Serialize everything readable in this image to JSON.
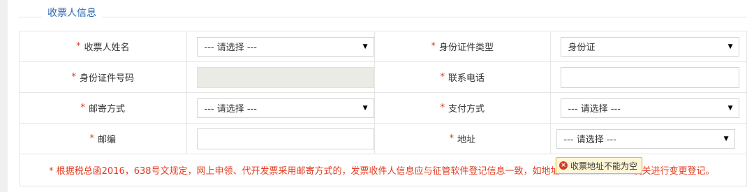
{
  "section": {
    "title": "收票人信息"
  },
  "rows": [
    {
      "left": {
        "label": "收票人姓名",
        "required": "*",
        "type": "select",
        "value": "--- 请选择 ---"
      },
      "right": {
        "label": "身份证件类型",
        "required": "*",
        "type": "select",
        "value": "身份证"
      }
    },
    {
      "left": {
        "label": "身份证件号码",
        "required": "*",
        "type": "input-disabled",
        "value": ""
      },
      "right": {
        "label": "联系电话",
        "required": "*",
        "type": "input",
        "value": ""
      }
    },
    {
      "left": {
        "label": "邮寄方式",
        "required": "*",
        "type": "select",
        "value": "--- 请选择 ---"
      },
      "right": {
        "label": "支付方式",
        "required": "*",
        "type": "select",
        "value": "--- 请选择 ---"
      }
    },
    {
      "left": {
        "label": "邮编",
        "required": "*",
        "type": "input",
        "value": ""
      },
      "right": {
        "label": "地址",
        "required": "*",
        "type": "select",
        "value": "--- 请选择 ---"
      }
    }
  ],
  "note": {
    "text_before": "* 根据税总函2016，638号文规定，网上申领、代开发票采用邮寄方式的，发票收件人信息应与征管软件登记信息一致，如地址",
    "text_after": "机关进行变更登记。"
  },
  "tooltip": {
    "text": "收票地址不能为空",
    "icon": "error-circle-icon"
  },
  "colors": {
    "accent": "#2f68b3",
    "required": "#e23b1f",
    "tooltip_bg": "#fff6d6"
  },
  "icons": {
    "dropdown": "caret-down-icon"
  }
}
